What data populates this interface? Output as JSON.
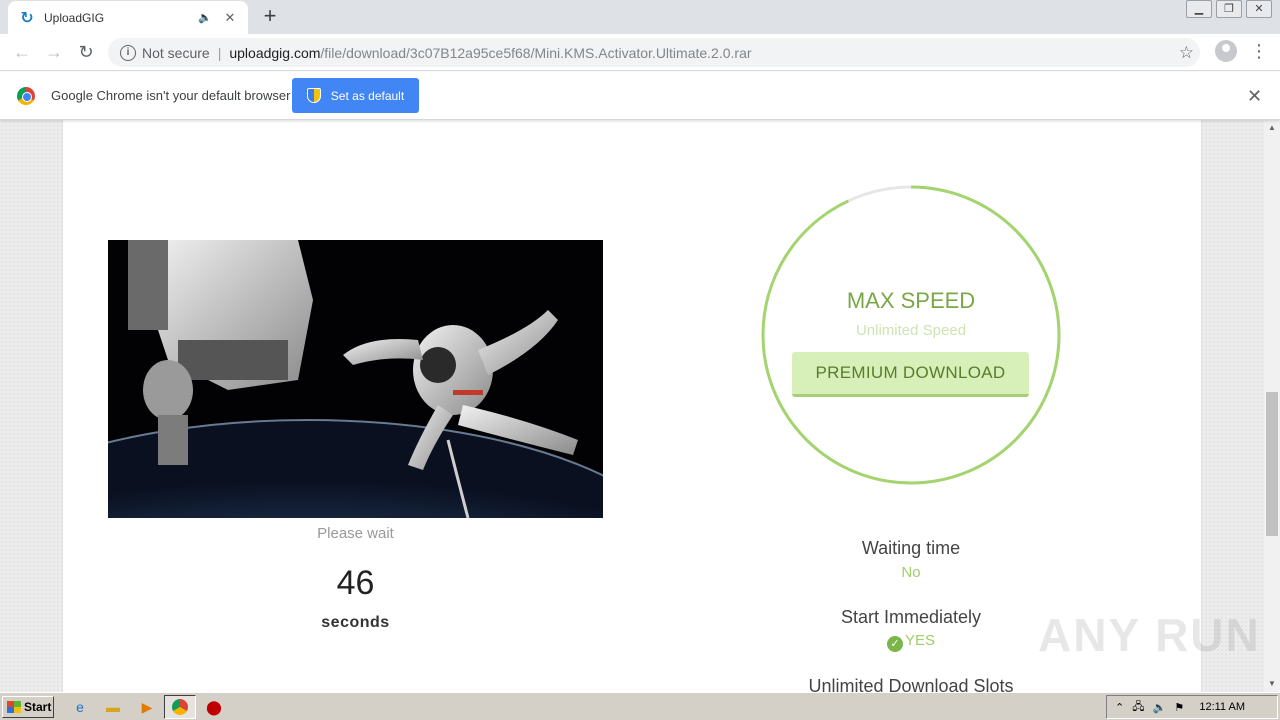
{
  "browser": {
    "tab_title": "UploadGIG",
    "tab_favicon": "uploadgig-logo-icon",
    "security_label": "Not secure",
    "url_host": "uploadgig.com",
    "url_path": "/file/download/3c07B12a95ce5f68/Mini.KMS.Activator.Ultimate.2.0.rar"
  },
  "infobar": {
    "message": "Google Chrome isn't your default browser",
    "button_label": "Set as default"
  },
  "page": {
    "please_wait": "Please wait",
    "countdown": "46",
    "countdown_unit": "seconds",
    "premium": {
      "title": "MAX SPEED",
      "subtitle": "Unlimited Speed",
      "button": "PREMIUM DOWNLOAD",
      "progress_fraction": 0.93
    },
    "features": [
      {
        "title": "Waiting time",
        "value": "No"
      },
      {
        "title": "Start Immediately",
        "value": "YES"
      },
      {
        "title": "Unlimited Download Slots",
        "value": ""
      }
    ]
  },
  "watermark": "ANY RUN",
  "taskbar": {
    "start_label": "Start",
    "clock": "12:11 AM"
  },
  "colors": {
    "accent_green": "#7aa745",
    "chrome_blue": "#4285f4"
  }
}
